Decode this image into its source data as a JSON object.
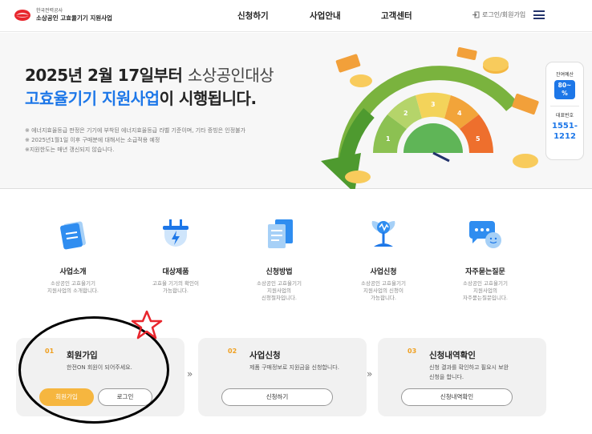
{
  "header": {
    "logo_top": "한국전력공사",
    "logo_bottom": "소상공인 고효율기기 지원사업",
    "nav": [
      "신청하기",
      "사업안내",
      "고객센터"
    ],
    "login": "로그인/회원가입"
  },
  "hero": {
    "line1_bold": "2025년 2월 17일부터 ",
    "line1_thin": "소상공인대상",
    "line2_blue": "고효율기기 지원사업",
    "line2_rest": "이 시행됩니다.",
    "notes": [
      "※ 에너지효율등급 판정은 기기에 부착된 에너지효율등급 라벨 기준이며, 기타 증빙은 인정불가",
      "※ 2025년1월1일 이후 구매분에 대해서는 소급적용 예정",
      "※지원한도는 매년 갱신되지 않습니다."
    ],
    "gauge_labels": [
      "1",
      "2",
      "3",
      "4",
      "5"
    ]
  },
  "side": {
    "budget_label": "잔여예산",
    "budget_value_top": "80~",
    "budget_value_bottom": "%",
    "phone_label": "대표번호",
    "phone_top": "1551-",
    "phone_bottom": "1212"
  },
  "menu": [
    {
      "title": "사업소개",
      "desc": [
        "소상공인 고효율기기",
        "지원사업의 소개합니다."
      ],
      "icon": "document-icon"
    },
    {
      "title": "대상제품",
      "desc": [
        "고효율 기기의 확인이",
        "가능합니다."
      ],
      "icon": "plug-icon"
    },
    {
      "title": "신청방법",
      "desc": [
        "소상공인 고효율기기",
        "지원사업의",
        "신청절차입니다."
      ],
      "icon": "files-icon"
    },
    {
      "title": "사업신청",
      "desc": [
        "소상공인 고효율기기",
        "지원사업의 신청이",
        "가능합니다."
      ],
      "icon": "plant-icon"
    },
    {
      "title": "자주묻는질문",
      "desc": [
        "소상공인 고효율기기",
        "지원사업의",
        "자주묻는질문입니다."
      ],
      "icon": "chat-icon"
    }
  ],
  "steps": [
    {
      "num": "01",
      "title": "회원가입",
      "desc": [
        "한전ON 회원이 되어주세요."
      ],
      "buttons": [
        "회원가입",
        "로그인"
      ]
    },
    {
      "num": "02",
      "title": "사업신청",
      "desc": [
        "제품 구매정보로 지원금을 신청합니다."
      ],
      "buttons": [
        "신청하기"
      ]
    },
    {
      "num": "03",
      "title": "신청내역확인",
      "desc": [
        "신청 결과를 확인하고 필요시 보완",
        "신청을 합니다."
      ],
      "buttons": [
        "신청내역확인"
      ]
    }
  ],
  "chevron": "»",
  "colors": {
    "accent_blue": "#1d77e8",
    "accent_orange": "#f6b63f",
    "navy": "#23336b"
  }
}
